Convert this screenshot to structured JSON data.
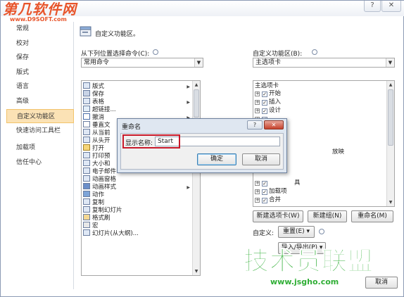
{
  "window": {
    "help_glyph": "?",
    "close_glyph": "✕"
  },
  "watermark_top": {
    "text": "第几软件网",
    "url": "www.D9SOFT.com"
  },
  "left_nav": {
    "items": [
      {
        "label": "常规"
      },
      {
        "label": "校对"
      },
      {
        "label": "保存"
      },
      {
        "label": "版式"
      },
      {
        "label": "语言"
      },
      {
        "label": "高级"
      },
      {
        "label": "自定义功能区",
        "selected": true
      },
      {
        "label": "快速访问工具栏"
      },
      {
        "label": "加载项"
      },
      {
        "label": "信任中心"
      }
    ]
  },
  "main": {
    "heading": "自定义功能区。",
    "choose_from_label": "从下列位置选择命令(C):",
    "choose_from_value": "常用命令",
    "customize_label": "自定义功能区(B):",
    "customize_value": "主选项卡",
    "commands": [
      {
        "label": "版式",
        "submenu": true
      },
      {
        "label": "保存"
      },
      {
        "label": "表格",
        "submenu": true
      },
      {
        "label": "超链接..."
      },
      {
        "label": "撤消",
        "submenu": true
      },
      {
        "label": "垂直文"
      },
      {
        "label": "从当前"
      },
      {
        "label": "从头开"
      },
      {
        "label": "打开"
      },
      {
        "label": "打印预"
      },
      {
        "label": "大小和"
      },
      {
        "label": "电子邮件"
      },
      {
        "label": "动画窗格"
      },
      {
        "label": "动画样式",
        "submenu": true
      },
      {
        "label": "动作"
      },
      {
        "label": "复制"
      },
      {
        "label": "复制幻灯片"
      },
      {
        "label": "格式刷"
      },
      {
        "label": "宏"
      },
      {
        "label": "幻灯片(从大纲)..."
      }
    ],
    "tree": [
      {
        "label": "主选项卡",
        "header": true
      },
      {
        "label": "开始",
        "checked": true
      },
      {
        "label": "插入",
        "checked": true
      },
      {
        "label": "设计",
        "checked": true
      },
      {
        "label": ""
      },
      {
        "label": ""
      },
      {
        "label": ""
      },
      {
        "label": "放映"
      },
      {
        "label": ""
      },
      {
        "label": ""
      },
      {
        "label": ""
      },
      {
        "label": ""
      },
      {
        "label": "具"
      },
      {
        "label": "加载项",
        "checked": true
      },
      {
        "label": "合并",
        "checked": true
      }
    ],
    "new_tab_button": "新建选项卡(W)",
    "new_group_button": "新建组(N)",
    "rename_button": "重命名(M)",
    "customizations_label": "自定义:",
    "reset_button": "重置(E) ▾",
    "import_export_button": "导入/导出(P) ▾",
    "cancel_button": "取消"
  },
  "dialog": {
    "title": "重命名",
    "help_glyph": "?",
    "close_glyph": "✕",
    "display_name_label": "显示名称:",
    "display_name_value": "Start",
    "ok_button": "确定",
    "cancel_button": "取消",
    "highlight_color": "#c8192a"
  },
  "watermark_bottom": {
    "text": "技术员联盟",
    "url": "www.jsgho.com"
  }
}
